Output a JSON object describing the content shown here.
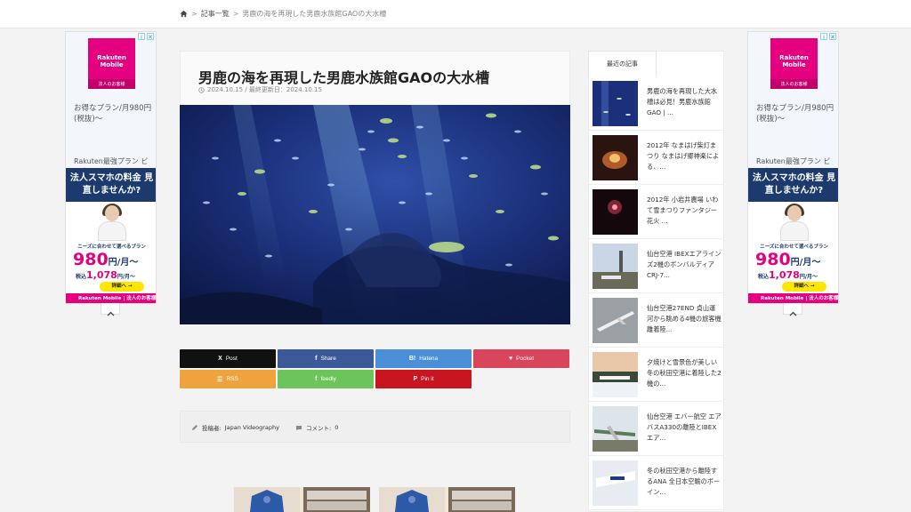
{
  "breadcrumb": {
    "items": [
      "記事一覧"
    ],
    "current": "男鹿の海を再現した男鹿水族館GAOの大水槽"
  },
  "ad": {
    "logo_line1": "Rakuten Mobile",
    "logo_line2": "法人のお客様",
    "text1": "お得なプラン/月980円(税抜)〜",
    "text2": "Rakuten最強プラン ビジネス",
    "banner_title": "法人スマホの料金 見直しませんか?",
    "banner_plan": "ニーズに合わせて選べるプラン",
    "price": "980",
    "price_unit": "円/月〜",
    "price2_prefix": "税込",
    "price2": "1,078",
    "price2_unit": "円/月〜",
    "cta": "詳細へ →",
    "footer": "Rakuten Mobile | 法人のお客様",
    "info_icon": "i",
    "close_icon": "✕"
  },
  "article": {
    "title": "男鹿の海を再現した男鹿水族館GAOの大水槽",
    "date": "2024.10.15 / 最終更新日：2024.10.15"
  },
  "share": {
    "buttons": [
      {
        "label": "Post",
        "icon": "X",
        "color": "#111111"
      },
      {
        "label": "Share",
        "icon": "f",
        "color": "#3b5998"
      },
      {
        "label": "Hatena",
        "icon": "B!",
        "color": "#4a8fd8"
      },
      {
        "label": "Pocket",
        "icon": "♥",
        "color": "#d9455a"
      },
      {
        "label": "RSS",
        "icon": "☰",
        "color": "#f0a33c"
      },
      {
        "label": "feedly",
        "icon": "f",
        "color": "#6cc55a"
      },
      {
        "label": "Pin it",
        "icon": "P",
        "color": "#c8151f"
      }
    ]
  },
  "author": {
    "label": "投稿者:",
    "name": "Japan Videography",
    "comments_label": "コメント:",
    "comments": "0"
  },
  "sidebar": {
    "tab": "最近の記事",
    "items": [
      {
        "title": "男鹿の海を再現した大水槽は必見！男鹿水族館GAO | ..."
      },
      {
        "title": "2012年 なまはげ柴灯まつり なまはげ郷神楽による、..."
      },
      {
        "title": "2012年 小岩井農場 いわて雪まつりファンタジー花火 ..."
      },
      {
        "title": "仙台空港 IBEXエアラインズ2機のボンバルディアCRJ-7..."
      },
      {
        "title": "仙台空港27END 貞山運河から眺める4機の旅客機離着陸..."
      },
      {
        "title": "夕焼けと雪景色が美しい冬の秋田空港に着陸した2機の..."
      },
      {
        "title": "仙台空港 エバー航空 エアバスA330の離陸とIBEXエア..."
      },
      {
        "title": "冬の秋田空港から離陸するANA 全日本空輸のボーイン..."
      }
    ]
  }
}
